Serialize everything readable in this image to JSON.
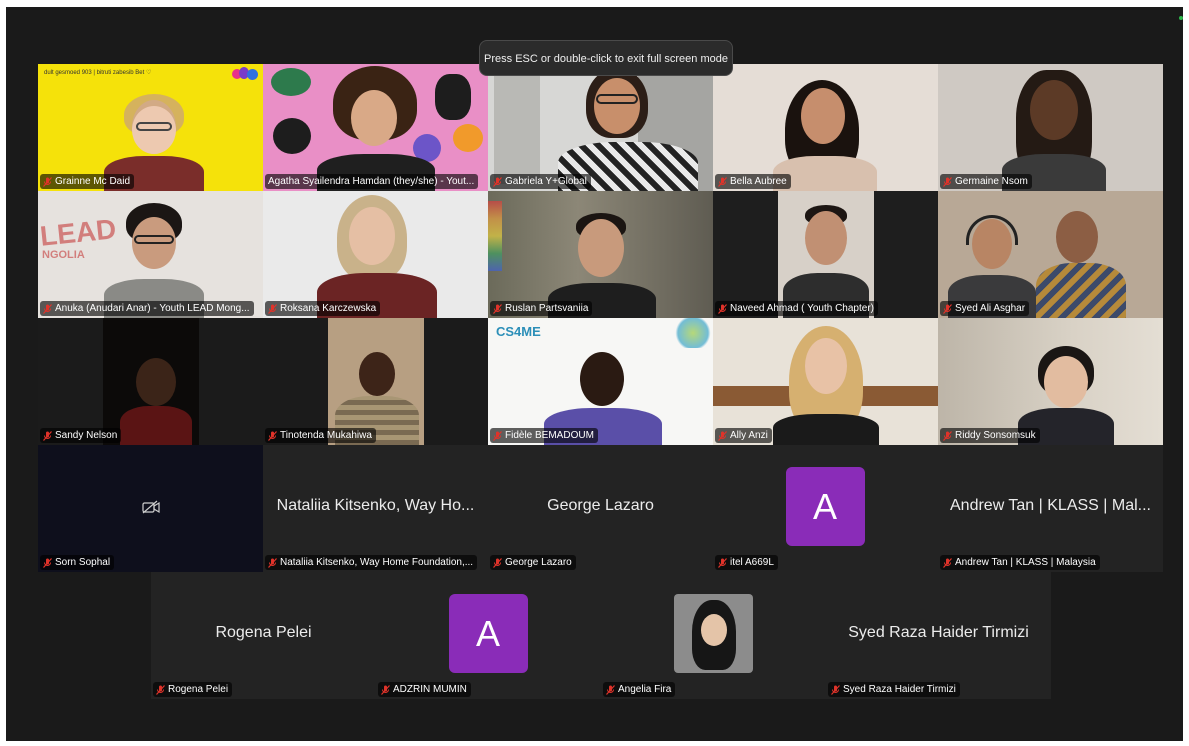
{
  "toast": "Press ESC or double-click to exit full screen mode",
  "tiles": [
    {
      "name": "Grainne Mc Daid",
      "banner": "dult gesmoed 903  |  bitruti zabesib Bet ♡"
    },
    {
      "name": "Agatha Syailendra Hamdan (they/she) - Yout..."
    },
    {
      "name": "Gabriela Y+Global"
    },
    {
      "name": "Bella Aubree"
    },
    {
      "name": "Germaine Nsom"
    },
    {
      "name": "Anuka (Anudari Anar) - Youth LEAD Mong...",
      "bg_text": "LEAD",
      "bg_text2": "NGOLIA"
    },
    {
      "name": "Roksana Karczewska"
    },
    {
      "name": "Ruslan Partsvaniia"
    },
    {
      "name": "Naveed Ahmad ( Youth Chapter)"
    },
    {
      "name": "Syed Ali Asghar"
    },
    {
      "name": "Sandy Nelson"
    },
    {
      "name": "Tinotenda Mukahiwa"
    },
    {
      "name": "Fidèle BEMADOUM",
      "logo": "CS4ME"
    },
    {
      "name": "Ally Anzi"
    },
    {
      "name": "Riddy Sonsomsuk"
    },
    {
      "name": "Sorn Sophal"
    },
    {
      "name": "Nataliia Kitsenko, Way Home Foundation,...",
      "big": "Nataliia Kitsenko, Way Ho..."
    },
    {
      "name": "George Lazaro",
      "big": "George Lazaro"
    },
    {
      "name": "itel A669L",
      "avatar": "A"
    },
    {
      "name": "Andrew Tan | KLASS | Malaysia",
      "big": "Andrew Tan | KLASS | Mal..."
    },
    {
      "name": "Rogena Pelei",
      "big": "Rogena Pelei"
    },
    {
      "name": "ADZRIN MUMIN",
      "avatar": "A"
    },
    {
      "name": "Angelia Fira"
    },
    {
      "name": "Syed Raza Haider Tirmizi",
      "big": "Syed Raza Haider Tirmizi"
    }
  ],
  "colors": {
    "speaking_border": "#2eb84b",
    "avatar_bg": "#8a2cb8",
    "mute_icon": "#e0332a"
  }
}
